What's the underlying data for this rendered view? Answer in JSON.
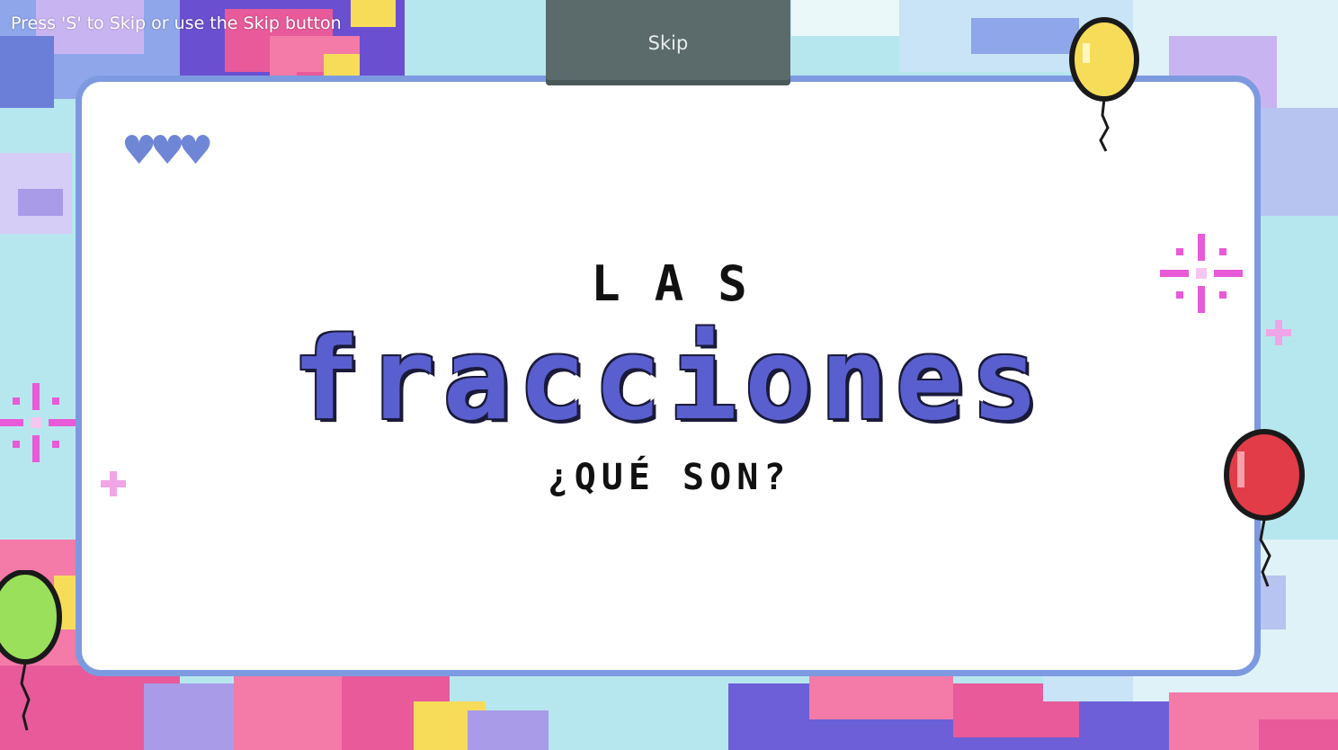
{
  "hud": {
    "skip_hint": "Press 'S' to Skip or use the Skip button",
    "skip_label": "Skip"
  },
  "slide": {
    "title_top": "LAS",
    "title_main": "fracciones",
    "subtitle": "¿QUÉ SON?",
    "hearts": "♥♥♥"
  },
  "palette": {
    "sky": "#b7e7ee",
    "frame": "#7d9ae0",
    "title_blue": "#5a5fcf",
    "balloon_yellow": "#f7dc5a",
    "balloon_red": "#e23c48",
    "balloon_green": "#9be05a",
    "sparkle_pink": "#e85ad8"
  },
  "decor": {
    "balloons": [
      "yellow-balloon-icon",
      "red-balloon-icon",
      "green-balloon-icon"
    ],
    "sparkles": [
      "sparkle-icon"
    ],
    "clouds": [
      "pixel-cloud"
    ]
  }
}
